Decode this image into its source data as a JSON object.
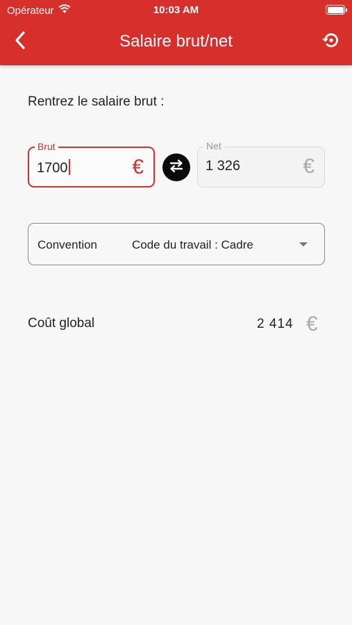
{
  "status_bar": {
    "carrier": "Opérateur",
    "time": "10:03 AM"
  },
  "header": {
    "title": "Salaire brut/net",
    "back_icon": "chevron-left-icon",
    "reset_icon": "history-reset-icon"
  },
  "prompt": "Rentrez le salaire brut :",
  "brut_field": {
    "label": "Brut",
    "value": "1700",
    "currency": "€"
  },
  "net_field": {
    "label": "Net",
    "value": "1 326",
    "currency": "€"
  },
  "swap_icon": "swap-arrows-icon",
  "convention": {
    "label": "Convention",
    "selected": "Code du travail : Cadre"
  },
  "global_cost": {
    "label": "Coût global",
    "value": "2 414",
    "currency": "€"
  },
  "colors": {
    "accent": "#d62f2c",
    "background": "#f7f7f7",
    "muted": "#aaaaaa"
  }
}
